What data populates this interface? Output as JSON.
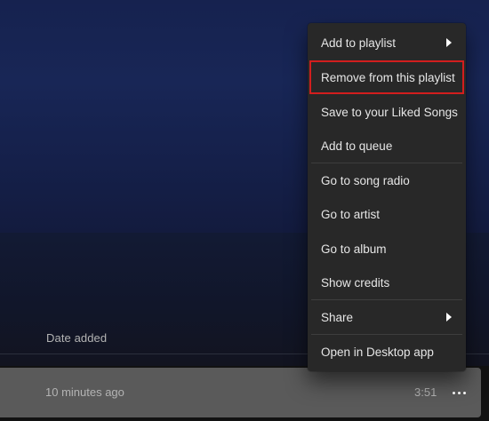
{
  "tracklist": {
    "column_header": "Date added",
    "row": {
      "date_added": "10 minutes ago",
      "duration": "3:51",
      "more_icon": "more-horizontal-icon"
    }
  },
  "context_menu": {
    "items": [
      {
        "label": "Add to playlist",
        "submenu": true
      },
      {
        "label": "Remove from this playlist",
        "highlighted": true
      },
      {
        "label": "Save to your Liked Songs"
      },
      {
        "label": "Add to queue"
      },
      {
        "label": "Go to song radio"
      },
      {
        "label": "Go to artist"
      },
      {
        "label": "Go to album"
      },
      {
        "label": "Show credits"
      },
      {
        "label": "Share",
        "submenu": true
      },
      {
        "label": "Open in Desktop app"
      }
    ]
  },
  "colors": {
    "header_gradient": "#182656",
    "menu_background": "#282828",
    "highlight_outline": "#d21e1e",
    "row_hover": "#5a5a5a"
  }
}
